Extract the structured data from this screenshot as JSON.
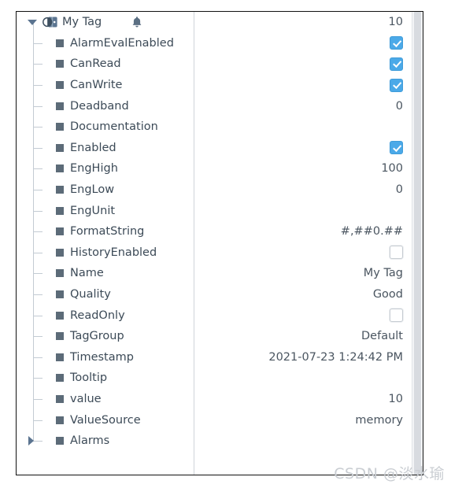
{
  "panel": {
    "name_column_width": 225,
    "colors": {
      "checkbox_checked": "#4ba9e8",
      "checkbox_unchecked_border": "#c6ccd2",
      "label_text": "#3c4a57",
      "value_text": "#4a5560",
      "tree_guide": "#c3cbd3",
      "panel_border": "#111111",
      "divider": "#cfd4d9",
      "watermark": "#c9cdd2"
    }
  },
  "tree": {
    "root": {
      "label": "My Tag",
      "value": "10",
      "expanded": true,
      "icon": "tag-icon",
      "badge_icon": "bell-icon"
    },
    "rows": [
      {
        "label": "AlarmEvalEnabled",
        "type": "checkbox",
        "value": "true"
      },
      {
        "label": "CanRead",
        "type": "checkbox",
        "value": "true"
      },
      {
        "label": "CanWrite",
        "type": "checkbox",
        "value": "true"
      },
      {
        "label": "Deadband",
        "type": "text",
        "value": "0"
      },
      {
        "label": "Documentation",
        "type": "text",
        "value": ""
      },
      {
        "label": "Enabled",
        "type": "checkbox",
        "value": "true"
      },
      {
        "label": "EngHigh",
        "type": "text",
        "value": "100"
      },
      {
        "label": "EngLow",
        "type": "text",
        "value": "0"
      },
      {
        "label": "EngUnit",
        "type": "text",
        "value": ""
      },
      {
        "label": "FormatString",
        "type": "text",
        "value": "#,##0.##"
      },
      {
        "label": "HistoryEnabled",
        "type": "checkbox",
        "value": "false"
      },
      {
        "label": "Name",
        "type": "text",
        "value": "My Tag"
      },
      {
        "label": "Quality",
        "type": "text",
        "value": "Good"
      },
      {
        "label": "ReadOnly",
        "type": "checkbox",
        "value": "false"
      },
      {
        "label": "TagGroup",
        "type": "text",
        "value": "Default"
      },
      {
        "label": "Timestamp",
        "type": "text",
        "value": "2021-07-23 1:24:42 PM"
      },
      {
        "label": "Tooltip",
        "type": "text",
        "value": ""
      },
      {
        "label": "value",
        "type": "text",
        "value": "10"
      },
      {
        "label": "ValueSource",
        "type": "text",
        "value": "memory"
      },
      {
        "label": "Alarms",
        "type": "expander",
        "value": "",
        "expanded": false
      }
    ]
  },
  "watermark": {
    "text": "CSDN @淡水瑜"
  }
}
